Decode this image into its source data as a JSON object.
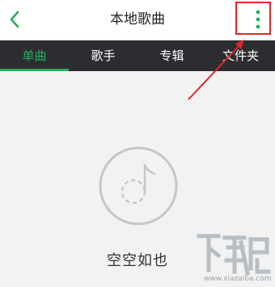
{
  "header": {
    "title": "本地歌曲",
    "back_icon": "chevron-left-icon",
    "more_icon": "more-vertical-icon",
    "accent_color": "#22b05a"
  },
  "tabs": [
    {
      "label": "单曲",
      "active": true
    },
    {
      "label": "歌手",
      "active": false
    },
    {
      "label": "专辑",
      "active": false
    },
    {
      "label": "文件夹",
      "active": false
    }
  ],
  "empty_state": {
    "icon": "music-disc-icon",
    "message": "空空如也"
  },
  "annotation": {
    "highlight_color": "#e0262b"
  },
  "watermark": {
    "logo_text": "下载吧",
    "url": "www.xiazaiba.com"
  }
}
